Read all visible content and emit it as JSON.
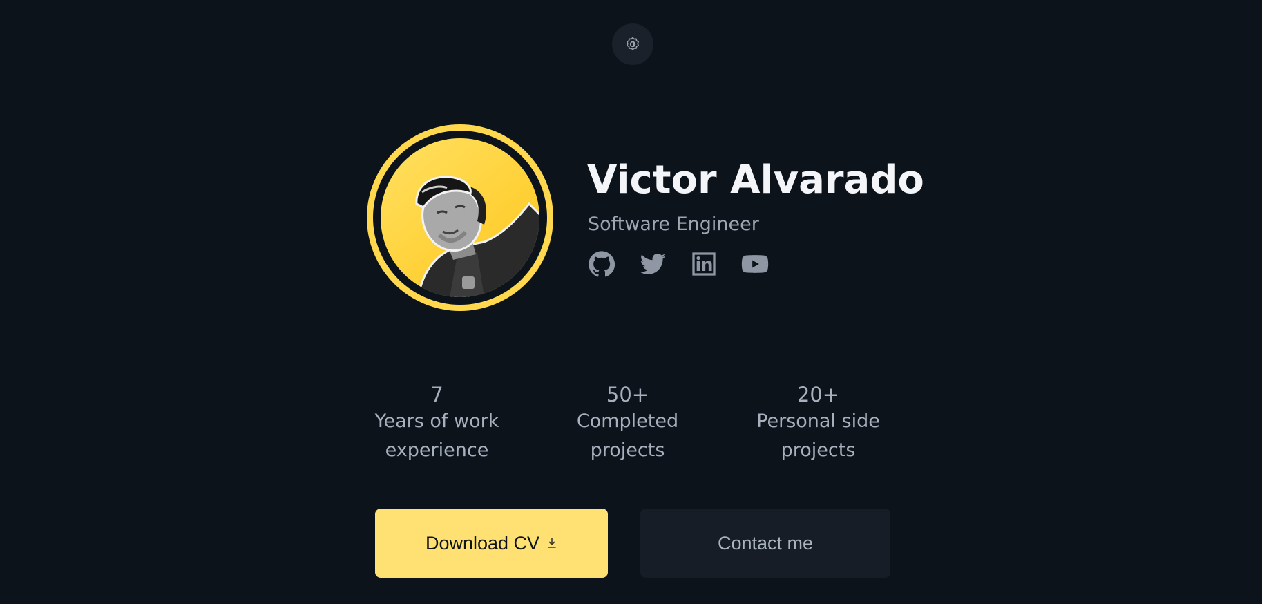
{
  "header": {
    "theme_toggle_icon": "gear-icon"
  },
  "profile": {
    "name": "Victor Alvarado",
    "role": "Software Engineer",
    "avatar_icon": "profile-photo",
    "accent_color": "#ffd84d",
    "socials": [
      {
        "name": "GitHub",
        "icon": "github-icon"
      },
      {
        "name": "Twitter",
        "icon": "twitter-icon"
      },
      {
        "name": "LinkedIn",
        "icon": "linkedin-icon"
      },
      {
        "name": "YouTube",
        "icon": "youtube-icon"
      }
    ]
  },
  "stats": [
    {
      "value": "7",
      "label": "Years of work\nexperience"
    },
    {
      "value": "50+",
      "label": "Completed\nprojects"
    },
    {
      "value": "20+",
      "label": "Personal side\nprojects"
    }
  ],
  "actions": {
    "download_label": "Download CV",
    "download_icon": "download-icon",
    "contact_label": "Contact me"
  },
  "colors": {
    "background": "#0c131b",
    "primary_button": "#ffe173",
    "secondary_button": "#161d26"
  }
}
